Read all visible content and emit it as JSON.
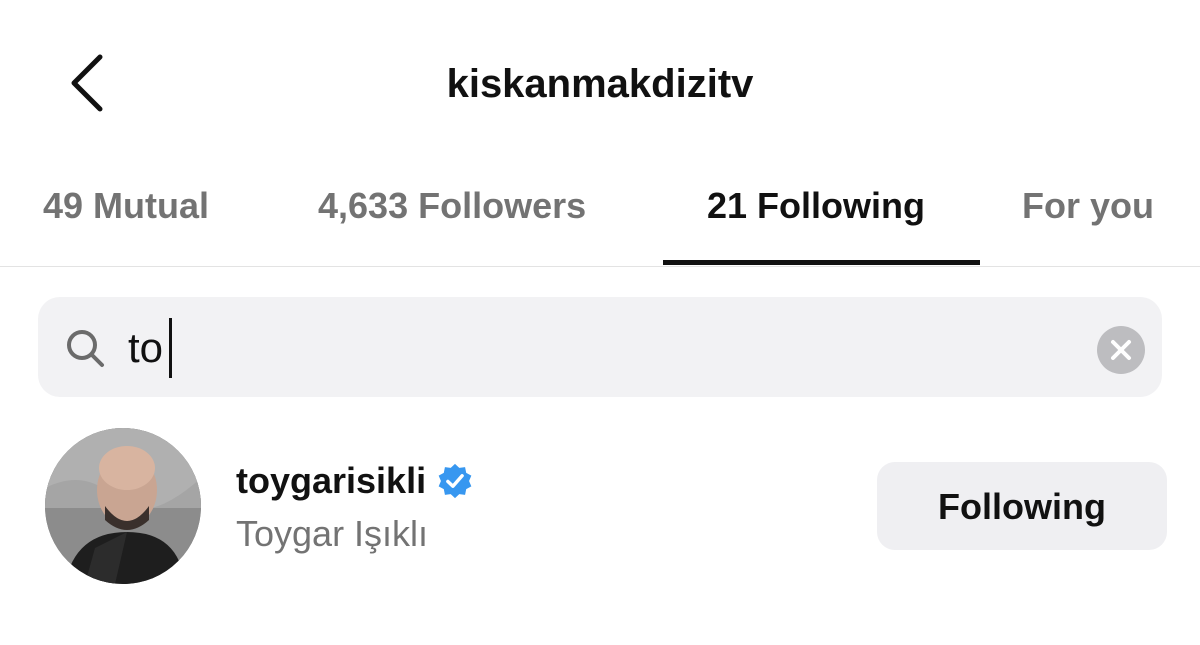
{
  "header": {
    "title": "kiskanmakdizitv",
    "back_icon": "chevron-left-icon"
  },
  "tabs": [
    {
      "label": "49 Mutual",
      "active": false
    },
    {
      "label": "4,633 Followers",
      "active": false
    },
    {
      "label": "21 Following",
      "active": true
    },
    {
      "label": "For you",
      "active": false
    }
  ],
  "search": {
    "value": "to",
    "icon": "search-icon",
    "clear_icon": "clear-icon"
  },
  "results": [
    {
      "username": "toygarisikli",
      "full_name": "Toygar Işıklı",
      "verified": true,
      "button_label": "Following"
    }
  ],
  "colors": {
    "verified": "#3797f0",
    "secondary_text": "#737373",
    "search_bg": "#f2f2f4",
    "button_bg": "#efeff2"
  }
}
